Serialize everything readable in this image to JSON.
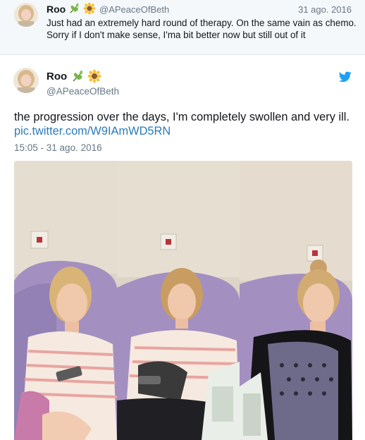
{
  "parent_tweet": {
    "name": "Roo",
    "handle": "@APeaceOfBeth",
    "date": "31 ago. 2016",
    "text": "Just had an extremely hard round of therapy. On the same vain as chemo. Sorry if I don't make sense, I'ma bit better now but still out of it"
  },
  "tweet": {
    "name": "Roo",
    "handle": "@APeaceOfBeth",
    "text": "the progression over the days, I'm completely swollen and very ill.",
    "link": "pic.twitter.com/W9IAmWD5RN",
    "timestamp": "15:05 - 31 ago. 2016"
  },
  "icons": {
    "name_emoji_1": "herb-icon",
    "name_emoji_2": "sunflower-icon",
    "brand": "twitter-bird-icon"
  },
  "colors": {
    "link": "#2b7bb9",
    "secondary_text": "#657786",
    "brand_blue": "#1da1f2",
    "context_background": "#f5f8fa",
    "chair_purple": "#a48fc1"
  },
  "media": {
    "panels": [
      "photo-day-1",
      "photo-day-2",
      "photo-day-3"
    ]
  }
}
